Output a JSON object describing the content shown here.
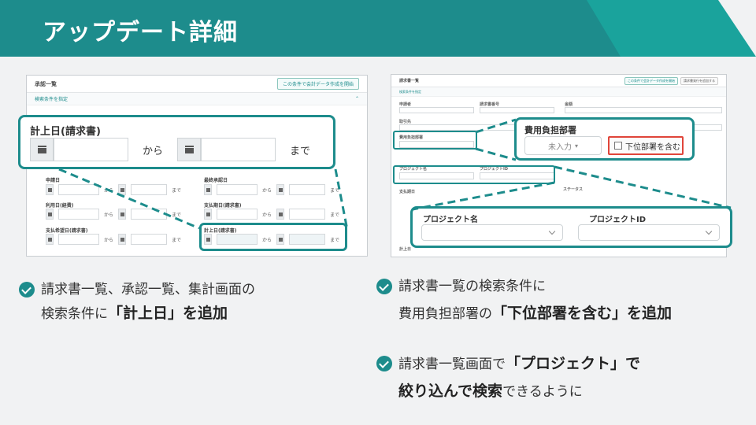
{
  "header": {
    "title": "アップデート詳細"
  },
  "left_shot": {
    "title": "承認一覧",
    "action_button": "この条件で会計データ作成を開始",
    "search_toggle": "検索条件を指定",
    "fields": [
      {
        "label": "申請日",
        "from": "から",
        "to": "まで"
      },
      {
        "label": "最終承認日",
        "from": "から",
        "to": "まで"
      },
      {
        "label": "利用日(経費)",
        "from": "から",
        "to": "まで"
      },
      {
        "label": "支払期日(請求書)",
        "from": "から",
        "to": "まで"
      },
      {
        "label": "支払希望日(請求書)",
        "from": "から",
        "to": "まで"
      },
      {
        "label": "計上日(請求書)",
        "from": "から",
        "to": "まで"
      }
    ]
  },
  "left_zoom": {
    "label": "計上日(請求書)",
    "from": "から",
    "to": "まで"
  },
  "right_shot": {
    "title": "請求書一覧",
    "action_button": "この条件で会計データ作成を開始",
    "sub_button": "請求書発行を追加する",
    "search_toggle": "検索条件を指定",
    "labels": {
      "applicant": "申請者",
      "number": "請求書番号",
      "amount": "金額",
      "partner": "取引先",
      "expense_dept": "費用負担部署",
      "sub_dept": "下位部署を含む",
      "project_name": "プロジェクト名",
      "project_id": "プロジェクトID",
      "status": "ステータス",
      "pay_date": "支払期日",
      "posted_date": "計上日"
    }
  },
  "dept_zoom": {
    "title": "費用負担部署",
    "select_value": "未入力",
    "checkbox_label": "下位部署を含む"
  },
  "project_zoom": {
    "name_label": "プロジェクト名",
    "id_label": "プロジェクトID"
  },
  "notes": {
    "left": {
      "line1": "請求書一覧、承認一覧、集計画面の",
      "line2_pre": "検索条件に",
      "line2_bold": "「計上日」を追加"
    },
    "right1": {
      "line1": "請求書一覧の検索条件に",
      "line2_pre": "費用負担部署の",
      "line2_bold": "「下位部署を含む」を追加"
    },
    "right2": {
      "line1_pre": "請求書一覧画面で",
      "line1_bold": "「プロジェクト」で",
      "line2_bold": "絞り込んで検索",
      "line2_post": "できるように"
    }
  },
  "colors": {
    "accent": "#1d8c8c",
    "highlight": "#e0453a"
  }
}
